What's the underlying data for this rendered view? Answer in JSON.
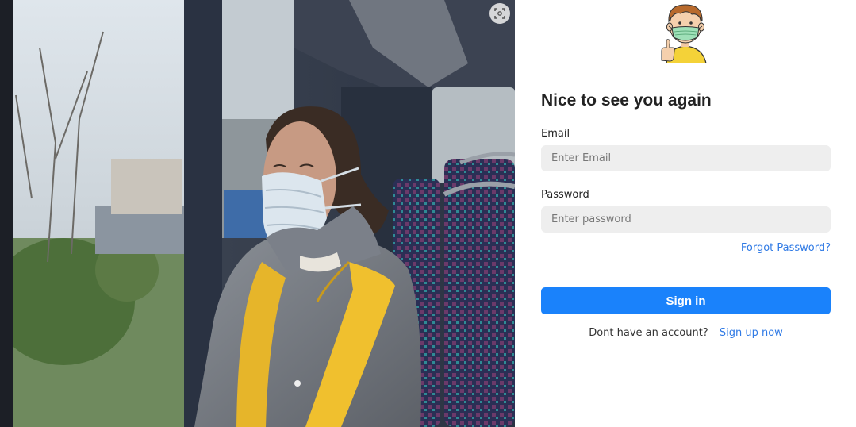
{
  "colors": {
    "accent": "#1a82fb",
    "link": "#2f7ae5",
    "input_bg": "#eeeeee",
    "heading": "#222222"
  },
  "photo": {
    "icon": "photo-woman-mask-bus",
    "lens_icon": "lens-scan-icon"
  },
  "avatar": {
    "icon": "masked-boy-thumbs-up-icon"
  },
  "form": {
    "heading": "Nice to see you again",
    "email_label": "Email",
    "email_placeholder": "Enter Email",
    "password_label": "Password",
    "password_placeholder": "Enter password",
    "forgot_link": "Forgot Password?",
    "signin_button": "Sign in",
    "no_account_text": "Dont have an account?",
    "signup_link": "Sign up now"
  }
}
